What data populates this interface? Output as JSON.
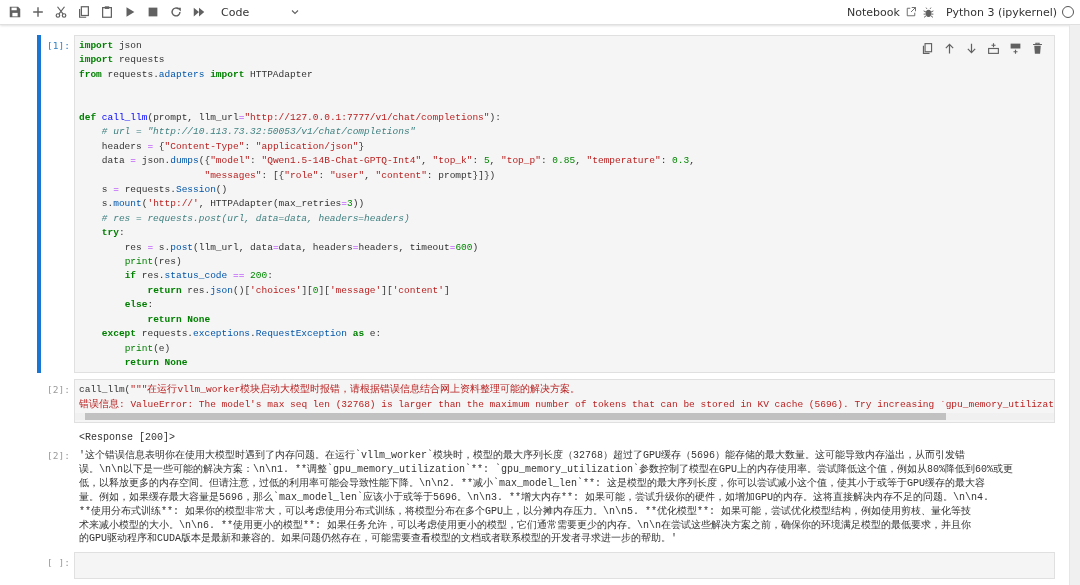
{
  "toolbar": {
    "cell_type": "Code",
    "view_link": "Notebook",
    "kernel_name": "Python 3 (ipykernel)",
    "kernel_busy": false
  },
  "cells": [
    {
      "kind": "code",
      "prompt": "[1]:",
      "selected": true,
      "scrollbar": false,
      "lines": [
        "import json\nimport requests\nfrom requests.adapters import HTTPAdapter\n\n",
        "def call_llm(prompt, llm_url=\"http://127.0.0.1:7777/v1/chat/completions\"):",
        "    # url = \"http://10.113.73.32:50053/v1/chat/completions\"",
        "    headers = {\"Content-Type\": \"application/json\"}",
        "    data = json.dumps({\"model\": \"Qwen1.5-14B-Chat-GPTQ-Int4\", \"top_k\": 5, \"top_p\": 0.85, \"temperature\": 0.3,",
        "                      \"messages\": [{\"role\": \"user\", \"content\": prompt}]})",
        "    s = requests.Session()",
        "    s.mount('http://', HTTPAdapter(max_retries=3))",
        "    # res = requests.post(url, data=data, headers=headers)",
        "    try:",
        "        res = s.post(llm_url, data=data, headers=headers, timeout=600)",
        "        print(res)",
        "        if res.status_code == 200:",
        "            return res.json()['choices'][0]['message']['content']",
        "        else:",
        "            return None",
        "    except requests.exceptions.RequestException as e:",
        "        print(e)",
        "        return None"
      ]
    },
    {
      "kind": "code",
      "prompt": "[2]:",
      "selected": false,
      "scrollbar": true,
      "lines": [
        "call_llm(\"\"\"在运行vllm_worker模块启动大模型时报错，请根据错误信息结合网上资料整理可能的解决方案。",
        "错误信息: ValueError: The model's max seq len (32768) is larger than the maximum number of tokens that can be stored in KV cache (5696). Try increasing `gpu_memory_utilizat"
      ],
      "outputs": [
        {
          "kind": "stream",
          "lines": [
            "<Response [200]>"
          ]
        },
        {
          "kind": "result",
          "prompt": "[2]:",
          "lines": [
            "'这个错误信息表明你在使用大模型时遇到了内存问题。在运行`vllm_worker`模块时，模型的最大序列长度（32768）超过了GPU缓存（5696）能存储的最大数量。这可能导致内存溢出，从而引发错",
            "误。\\n\\n以下是一些可能的解决方案：\\n\\n1. **调整`gpu_memory_utilization`**: `gpu_memory_utilization`参数控制了模型在GPU上的内存使用率。尝试降低这个值，例如从80%降低到60%或更",
            "低，以释放更多的内存空间。但请注意，过低的利用率可能会导致性能下降。\\n\\n2. **减小`max_model_len`**: 这是模型的最大序列长度，你可以尝试减小这个值，使其小于或等于GPU缓存的最大容",
            "量。例如，如果缓存最大容量是5696，那么`max_model_len`应该小于或等于5696。\\n\\n3. **增大内存**: 如果可能，尝试升级你的硬件，如增加GPU的内存。这将直接解决内存不足的问题。\\n\\n4.",
            "**使用分布式训练**: 如果你的模型非常大，可以考虑使用分布式训练，将模型分布在多个GPU上，以分摊内存压力。\\n\\n5. **优化模型**: 如果可能，尝试优化模型结构，例如使用剪枝、量化等技",
            "术来减小模型的大小。\\n\\n6. **使用更小的模型**: 如果任务允许，可以考虑使用更小的模型，它们通常需要更少的内存。\\n\\n在尝试这些解决方案之前，确保你的环境满足模型的最低要求，并且你",
            "的GPU驱动程序和CUDA版本是最新和兼容的。如果问题仍然存在，可能需要查看模型的文档或者联系模型的开发者寻求进一步的帮助。'"
          ]
        }
      ]
    },
    {
      "kind": "code",
      "prompt": "[ ]:",
      "selected": false,
      "scrollbar": false
    }
  ]
}
